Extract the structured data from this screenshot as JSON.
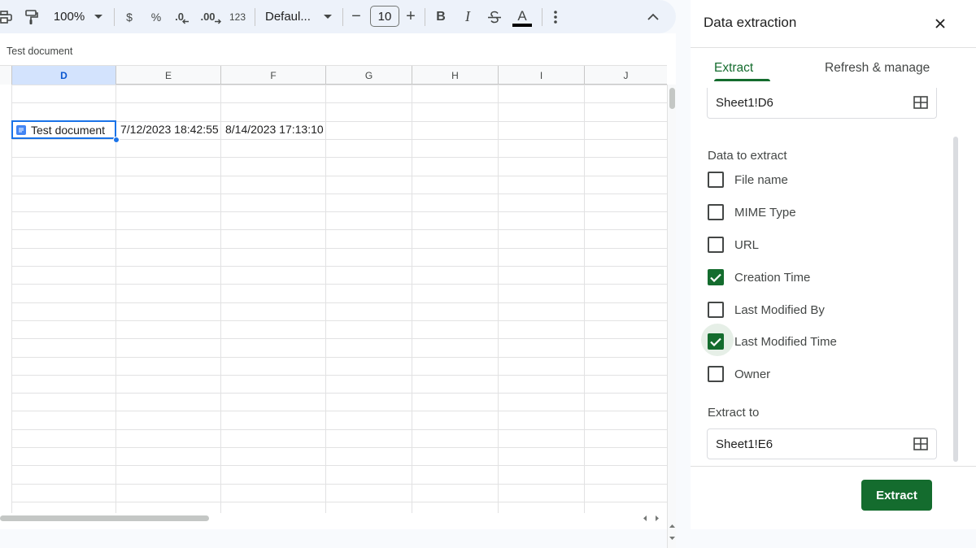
{
  "toolbar": {
    "zoom": "100%",
    "currency": "$",
    "percent": "%",
    "decrease_decimal": ".0",
    "increase_decimal": ".00",
    "number_format": "123",
    "font": "Defaul...",
    "font_size_minus": "−",
    "font_size": "10",
    "font_size_plus": "+",
    "bold": "B",
    "italic": "I",
    "text_color_letter": "A"
  },
  "sheet": {
    "doc_label": "Test document",
    "columns": [
      "D",
      "E",
      "F",
      "G",
      "H",
      "I",
      "J"
    ],
    "selected_column": "D",
    "row6": {
      "d": "Test document",
      "e": "7/12/2023 18:42:55",
      "f": "8/14/2023 17:13:10"
    }
  },
  "panel": {
    "title": "Data extraction",
    "tabs": [
      {
        "label": "Extract",
        "active": true
      },
      {
        "label": "Refresh & manage",
        "active": false
      }
    ],
    "source_field": "Sheet1!D6",
    "data_label": "Data to extract",
    "options": [
      {
        "label": "File name",
        "checked": false
      },
      {
        "label": "MIME Type",
        "checked": false
      },
      {
        "label": "URL",
        "checked": false
      },
      {
        "label": "Creation Time",
        "checked": true
      },
      {
        "label": "Last Modified By",
        "checked": false
      },
      {
        "label": "Last Modified Time",
        "checked": true
      },
      {
        "label": "Owner",
        "checked": false
      }
    ],
    "extract_to_label": "Extract to",
    "extract_to_field": "Sheet1!E6",
    "extract_button": "Extract"
  },
  "colors": {
    "accent_green": "#146c2e",
    "selection_blue": "#1a73e8",
    "toolbar_bg": "#edf2fa"
  }
}
